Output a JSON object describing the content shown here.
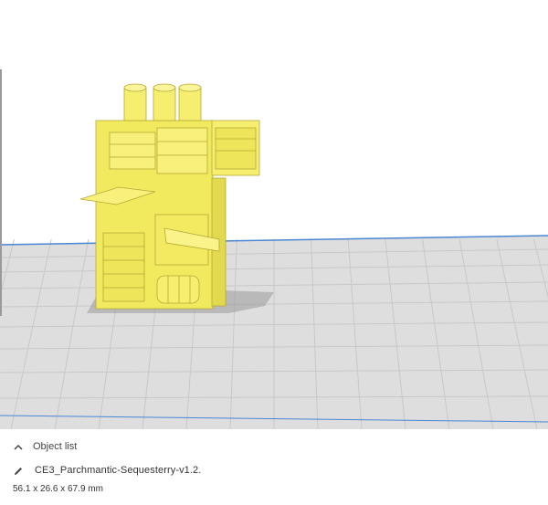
{
  "object_panel": {
    "list_toggle_label": "Object list",
    "toggle_icon": "chevron-up-icon",
    "edit_icon": "pencil-icon",
    "object_name": "CE3_Parchmantic-Sequesterry-v1.2.",
    "dimensions": "56.1 x 26.6 x 67.9 mm"
  },
  "colors": {
    "model": "#f5ee6e",
    "build_plate": "#e0e0e0",
    "grid_line": "#c6c6c6",
    "plate_edge": "#4a86d6",
    "background": "#ffffff"
  }
}
